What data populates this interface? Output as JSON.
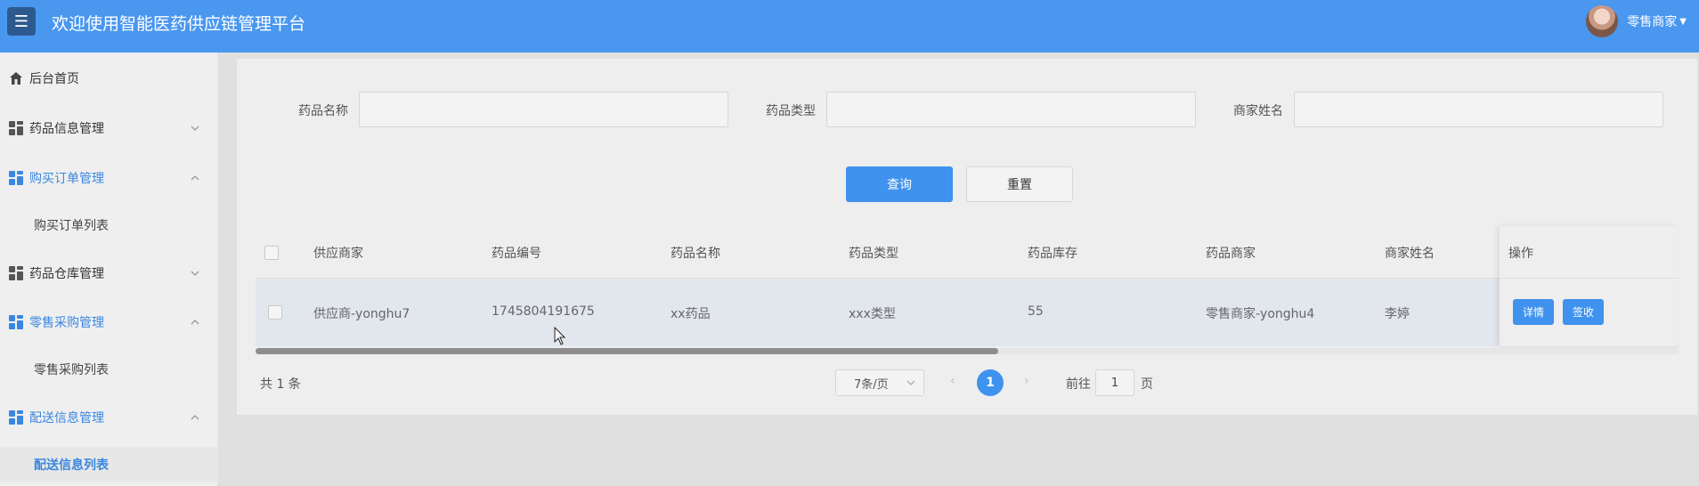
{
  "header": {
    "menu_icon": "hamburger-icon",
    "title": "欢迎使用智能医药供应链管理平台",
    "user_name": "零售商家",
    "bg_color": "#4a97f0"
  },
  "sidebar": {
    "home": "后台首页",
    "groups": [
      {
        "label": "药品信息管理",
        "expanded": false
      },
      {
        "label": "购买订单管理",
        "expanded": true,
        "sub": "购买订单列表"
      },
      {
        "label": "药品仓库管理",
        "expanded": false
      },
      {
        "label": "零售采购管理",
        "expanded": true,
        "sub": "零售采购列表"
      },
      {
        "label": "配送信息管理",
        "expanded": true,
        "sub": "配送信息列表"
      }
    ],
    "active_color": "#3a87e0"
  },
  "search": {
    "labels": [
      "药品名称",
      "药品类型",
      "商家姓名"
    ],
    "values": [
      "",
      "",
      ""
    ],
    "query_label": "查询",
    "reset_label": "重置"
  },
  "table": {
    "columns": [
      "供应商家",
      "药品编号",
      "药品名称",
      "药品类型",
      "药品库存",
      "药品商家",
      "商家姓名",
      "操作"
    ],
    "rows": [
      {
        "supplier": "供应商-yonghu7",
        "code": "1745804191675",
        "name": "xx药品",
        "type": "xxx类型",
        "stock": "55",
        "merchant": "零售商家-yonghu4",
        "merchant_name": "李婷",
        "detail_label": "详情",
        "sign_label": "签收"
      }
    ]
  },
  "pagination": {
    "total_text": "共 1 条",
    "page_size": "7条/页",
    "current_page": "1",
    "goto_prefix": "前往",
    "goto_value": "1",
    "goto_suffix": "页"
  }
}
